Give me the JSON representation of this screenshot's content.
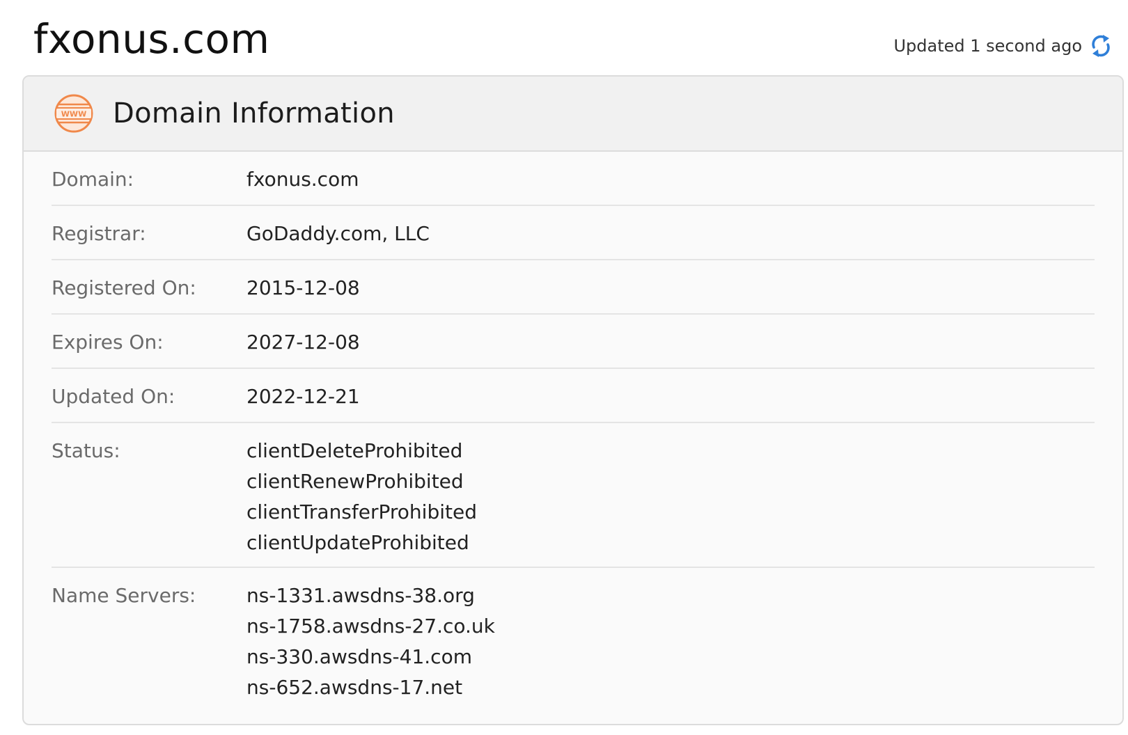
{
  "page": {
    "title": "fxonus.com",
    "updated_text": "Updated 1 second ago"
  },
  "card": {
    "title": "Domain Information",
    "icon": "www-icon",
    "icon_text": "WWW"
  },
  "rows": {
    "domain": {
      "label": "Domain:",
      "value": "fxonus.com"
    },
    "registrar": {
      "label": "Registrar:",
      "value": "GoDaddy.com, LLC"
    },
    "registered": {
      "label": "Registered On:",
      "value": "2015-12-08"
    },
    "expires": {
      "label": "Expires On:",
      "value": "2027-12-08"
    },
    "updated": {
      "label": "Updated On:",
      "value": "2022-12-21"
    },
    "status": {
      "label": "Status:",
      "values": [
        "clientDeleteProhibited",
        "clientRenewProhibited",
        "clientTransferProhibited",
        "clientUpdateProhibited"
      ]
    },
    "name_servers": {
      "label": "Name Servers:",
      "values": [
        "ns-1331.awsdns-38.org",
        "ns-1758.awsdns-27.co.uk",
        "ns-330.awsdns-41.com",
        "ns-652.awsdns-17.net"
      ]
    }
  },
  "colors": {
    "accent_orange": "#f0884a",
    "refresh_blue": "#2f7fd8"
  }
}
